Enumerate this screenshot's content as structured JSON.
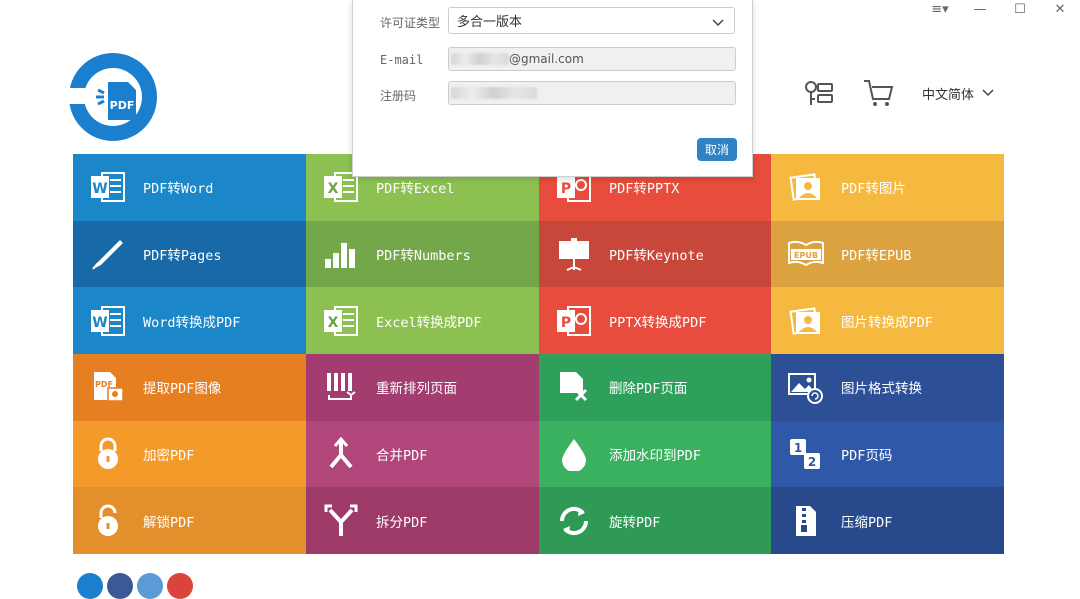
{
  "window": {
    "menu_icon": "≡▾",
    "minimize": "—",
    "maximize": "☐",
    "close": "✕"
  },
  "header": {
    "language": "中文简体",
    "key_icon": "key-icon",
    "cart_icon": "cart-icon"
  },
  "dialog": {
    "license_label": "许可证类型",
    "license_value": "多合一版本",
    "email_label": "E-mail",
    "email_value": "@gmail.com",
    "code_label": "注册码",
    "cancel_label": "取消"
  },
  "tiles": [
    {
      "label": "PDF转Word",
      "color": "#1b87c9",
      "icon": "word-icon"
    },
    {
      "label": "PDF转Excel",
      "color": "#8cc152",
      "icon": "excel-icon"
    },
    {
      "label": "PDF转PPTX",
      "color": "#e74c3c",
      "icon": "powerpoint-icon"
    },
    {
      "label": "PDF转图片",
      "color": "#f6b940",
      "icon": "image-icon"
    },
    {
      "label": "PDF转Pages",
      "color": "#1769a8",
      "icon": "pen-icon"
    },
    {
      "label": "PDF转Numbers",
      "color": "#74a64a",
      "icon": "bar-chart-icon"
    },
    {
      "label": "PDF转Keynote",
      "color": "#c9473a",
      "icon": "keynote-icon"
    },
    {
      "label": "PDF转EPUB",
      "color": "#dba23f",
      "icon": "epub-icon"
    },
    {
      "label": "Word转换成PDF",
      "color": "#1b87c9",
      "icon": "word-icon"
    },
    {
      "label": "Excel转换成PDF",
      "color": "#8cc152",
      "icon": "excel-icon"
    },
    {
      "label": "PPTX转换成PDF",
      "color": "#e74c3c",
      "icon": "powerpoint-icon"
    },
    {
      "label": "图片转换成PDF",
      "color": "#f6b940",
      "icon": "image-icon"
    },
    {
      "label": "提取PDF图像",
      "color": "#e67e22",
      "icon": "extract-image-icon"
    },
    {
      "label": "重新排列页面",
      "color": "#a33d6f",
      "icon": "rearrange-icon"
    },
    {
      "label": "删除PDF页面",
      "color": "#2fa05b",
      "icon": "delete-page-icon"
    },
    {
      "label": "图片格式转换",
      "color": "#2c4f96",
      "icon": "image-convert-icon"
    },
    {
      "label": "加密PDF",
      "color": "#f39a2b",
      "icon": "lock-icon"
    },
    {
      "label": "合并PDF",
      "color": "#b04679",
      "icon": "merge-icon"
    },
    {
      "label": "添加水印到PDF",
      "color": "#3ab15e",
      "icon": "water-drop-icon"
    },
    {
      "label": "PDF页码",
      "color": "#2f59a8",
      "icon": "page-number-icon"
    },
    {
      "label": "解锁PDF",
      "color": "#e38f2b",
      "icon": "unlock-icon"
    },
    {
      "label": "拆分PDF",
      "color": "#9e3a68",
      "icon": "split-icon"
    },
    {
      "label": "旋转PDF",
      "color": "#2e9a55",
      "icon": "rotate-icon"
    },
    {
      "label": "压缩PDF",
      "color": "#284a8c",
      "icon": "zip-icon"
    }
  ]
}
